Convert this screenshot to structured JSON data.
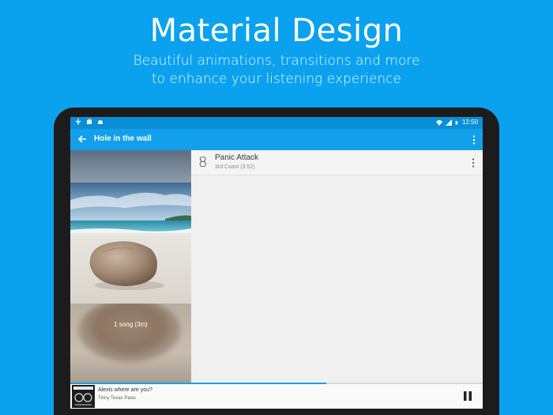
{
  "promo": {
    "headline": "Material Design",
    "subline_1": "Beautiful animations, transitions and more",
    "subline_2": "to enhance your listening experience"
  },
  "status_bar": {
    "time": "12:50",
    "icons": [
      "usb-icon",
      "notifications-icon",
      "android-debug-icon",
      "wifi-icon",
      "signal-icon",
      "battery-icon"
    ]
  },
  "app_bar": {
    "title": "Hole in the wall",
    "back_icon": "arrow-back-icon",
    "menu_icon": "more-vert-icon"
  },
  "album": {
    "song_count": "1 song (3m)"
  },
  "tracks": [
    {
      "number": "8",
      "title": "Panic Attack",
      "subtitle": "3rd Coast (3:52)"
    }
  ],
  "now_playing": {
    "title": "Alexis where are you?",
    "artist": "Tinny Texas Paws",
    "progress": 0.62,
    "pause_icon": "pause-icon"
  },
  "colors": {
    "background": "#0aa2ef",
    "app_bar": "#12a0ea",
    "status_bar": "#0a8fd6",
    "accent": "#1a9fe8"
  }
}
